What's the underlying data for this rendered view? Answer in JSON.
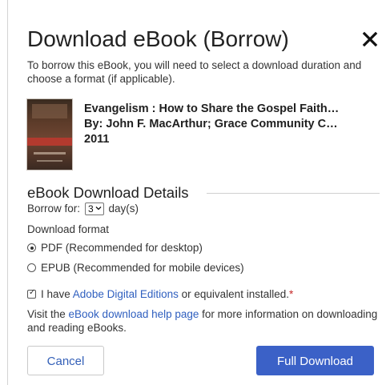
{
  "dialog": {
    "title": "Download eBook (Borrow)",
    "close_icon": "close-icon",
    "intro": "To borrow this eBook, you will need to select a download duration and choose a format (if applicable)."
  },
  "book": {
    "title_line": "Evangelism : How to Share the Gospel Faith…",
    "author_line": "By: John F. MacArthur; Grace Community C…",
    "year": "2011",
    "cover_icon": "book-cover-image"
  },
  "details": {
    "heading": "eBook Download Details",
    "borrow_label": "Borrow for:",
    "borrow_value": "3",
    "borrow_unit": "day(s)",
    "format_label": "Download format",
    "formats": [
      {
        "label": "PDF (Recommended for desktop)",
        "selected": true
      },
      {
        "label": "EPUB (Recommended for mobile devices)",
        "selected": false
      }
    ],
    "confirm_prefix": "I have ",
    "confirm_link": "Adobe Digital Editions",
    "confirm_suffix": " or equivalent installed.",
    "confirm_required": "*",
    "confirm_checked": true,
    "help_prefix": "Visit the ",
    "help_link": "eBook download help page",
    "help_suffix": " for more information on downloading and reading eBooks."
  },
  "actions": {
    "cancel_label": "Cancel",
    "download_label": "Full Download"
  },
  "colors": {
    "primary": "#3b61c7",
    "link": "#2f5fbf",
    "required": "#c62828"
  }
}
